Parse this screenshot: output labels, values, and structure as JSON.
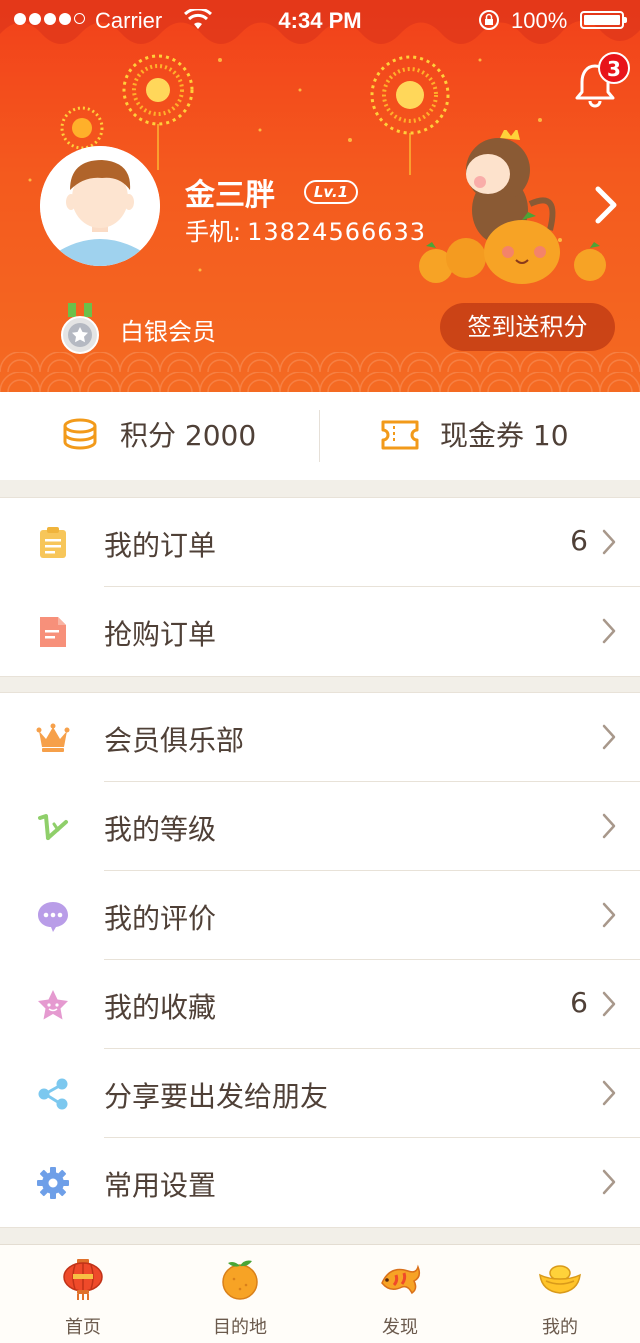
{
  "status_bar": {
    "carrier": "Carrier",
    "time": "4:34 PM",
    "battery": "100%"
  },
  "header": {
    "notification_count": "3",
    "username": "金三胖",
    "level": "Lv.1",
    "phone_label": "手机:",
    "phone_number": "13824566633",
    "member_level": "白银会员",
    "checkin_button": "签到送积分"
  },
  "stats": {
    "points_label": "积分 2000",
    "coupons_label": "现金券 10"
  },
  "menu_groups": [
    {
      "items": [
        {
          "label": "我的订单",
          "count": "6",
          "icon": "order-clipboard-icon",
          "color": "#f7c65a"
        },
        {
          "label": "抢购订单",
          "count": "",
          "icon": "flash-order-document-icon",
          "color": "#f7907a"
        }
      ]
    },
    {
      "items": [
        {
          "label": "会员俱乐部",
          "count": "",
          "icon": "crown-icon",
          "color": "#f6a04a"
        },
        {
          "label": "我的等级",
          "count": "",
          "icon": "level-icon",
          "color": "#8fcf6a"
        },
        {
          "label": "我的评价",
          "count": "",
          "icon": "comment-bubble-icon",
          "color": "#b99de8"
        },
        {
          "label": "我的收藏",
          "count": "6",
          "icon": "star-favorite-icon",
          "color": "#e59ad0"
        },
        {
          "label": "分享要出发给朋友",
          "count": "",
          "icon": "share-icon",
          "color": "#7cc8ef"
        },
        {
          "label": "常用设置",
          "count": "",
          "icon": "settings-gear-icon",
          "color": "#6e9fe8"
        }
      ]
    }
  ],
  "tabbar": {
    "tabs": [
      {
        "label": "首页",
        "icon": "lantern-icon"
      },
      {
        "label": "目的地",
        "icon": "tangerine-icon"
      },
      {
        "label": "发现",
        "icon": "koi-fish-icon"
      },
      {
        "label": "我的",
        "icon": "gold-ingot-icon"
      }
    ]
  },
  "colors": {
    "header_red": "#f2401a",
    "accent_orange": "#f29a1a",
    "text_brown": "#4f4037"
  }
}
